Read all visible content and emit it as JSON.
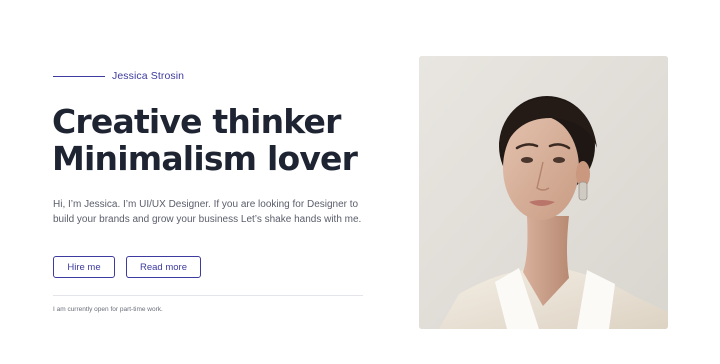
{
  "hero": {
    "eyebrow": "Jessica Strosin",
    "headline_line1": "Creative thinker",
    "headline_line2": "Minimalism lover",
    "intro": "Hi, I’m Jessica. I’m UI/UX Designer. If you are looking for Designer to build your brands and grow your business Let’s shake hands with me.",
    "buttons": {
      "hire_label": "Hire me",
      "read_label": "Read more"
    },
    "availability": "I am currently open for part-time work."
  },
  "colors": {
    "accent": "#3d3aa0",
    "heading": "#1f2433",
    "body_text": "#5a5e6b",
    "photo_background": "#e6e3de"
  },
  "portrait": {
    "image": "portrait-photo"
  }
}
